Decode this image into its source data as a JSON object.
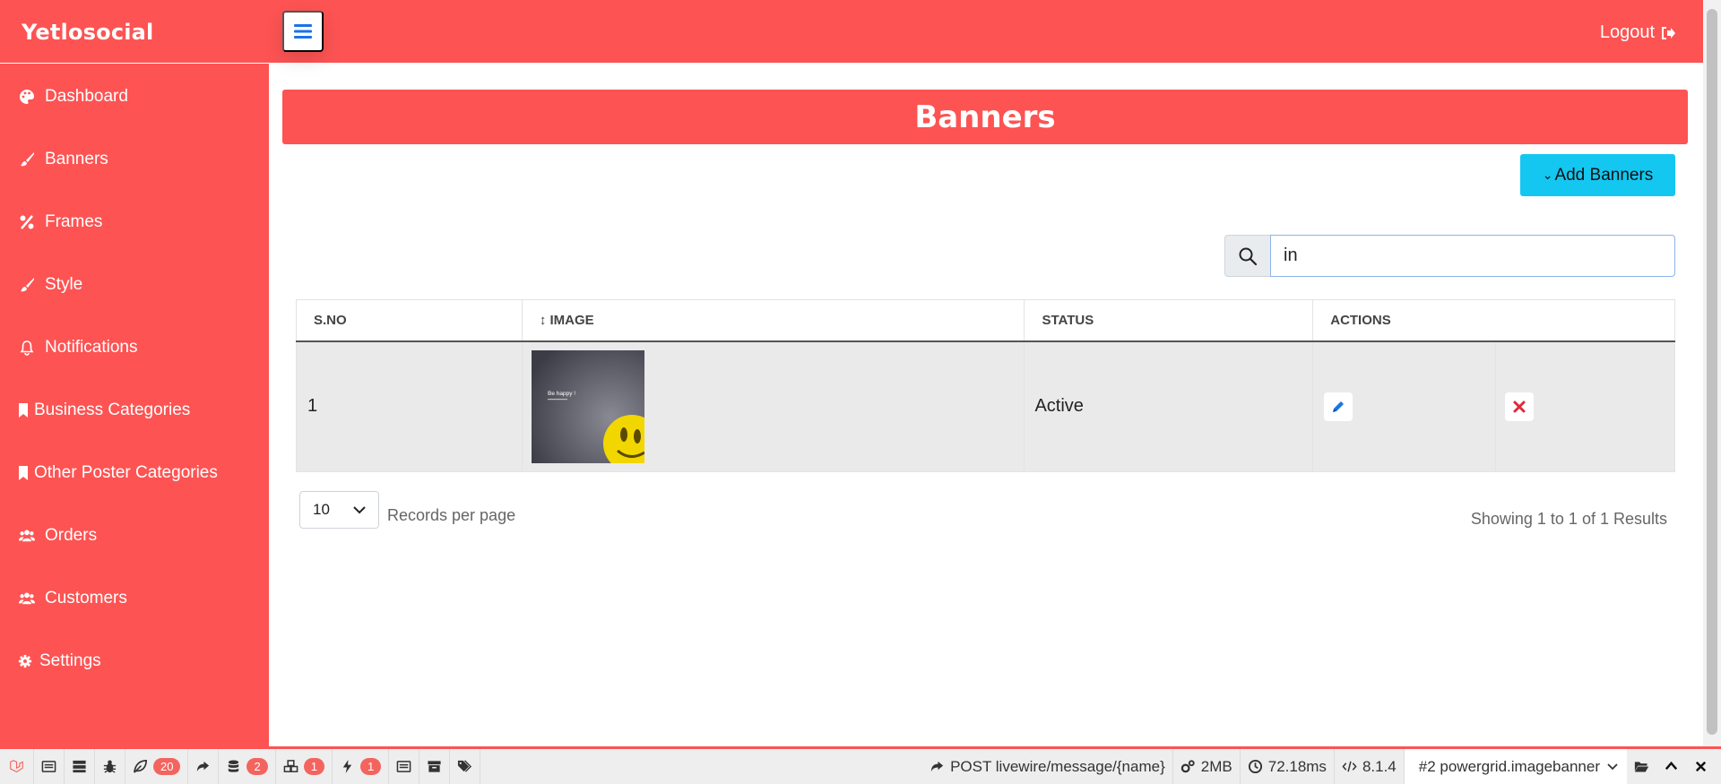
{
  "app": {
    "brand": "Yetlosocial",
    "logout_label": "Logout"
  },
  "sidebar": {
    "items": [
      {
        "label": "Dashboard",
        "icon": "palette-icon"
      },
      {
        "label": "Banners",
        "icon": "paint-brush-icon"
      },
      {
        "label": "Frames",
        "icon": "percent-icon"
      },
      {
        "label": "Style",
        "icon": "paint-brush-icon"
      },
      {
        "label": "Notifications",
        "icon": "bell-icon"
      },
      {
        "label": "Business Categories",
        "icon": "bookmark-icon"
      },
      {
        "label": "Other Poster Categories",
        "icon": "bookmark-icon"
      },
      {
        "label": "Orders",
        "icon": "users-icon"
      },
      {
        "label": "Customers",
        "icon": "users-icon"
      },
      {
        "label": "Settings",
        "icon": "gear-icon"
      }
    ]
  },
  "page": {
    "title": "Banners",
    "add_button": "Add Banners",
    "search_value": "in"
  },
  "table": {
    "headers": [
      "S.NO",
      "IMAGE",
      "STATUS",
      "ACTIONS"
    ],
    "sort_indicator": "↕",
    "rows": [
      {
        "sno": "1",
        "image_text": "Be happy !",
        "status": "Active"
      }
    ]
  },
  "pagination": {
    "per_page": "10",
    "per_page_label": "Records per page",
    "results": "Showing 1 to 1 of 1 Results"
  },
  "debugbar": {
    "badges": {
      "models": "20",
      "queries": "2",
      "components": "1",
      "events": "1"
    },
    "route": "POST livewire/message/{name}",
    "memory": "2MB",
    "time": "72.18ms",
    "php": "8.1.4",
    "request": "#2 powergrid.imagebanner"
  },
  "colors": {
    "primary": "#fd5353",
    "accent": "#13c7f1",
    "debug_badge": "#f4645f"
  }
}
